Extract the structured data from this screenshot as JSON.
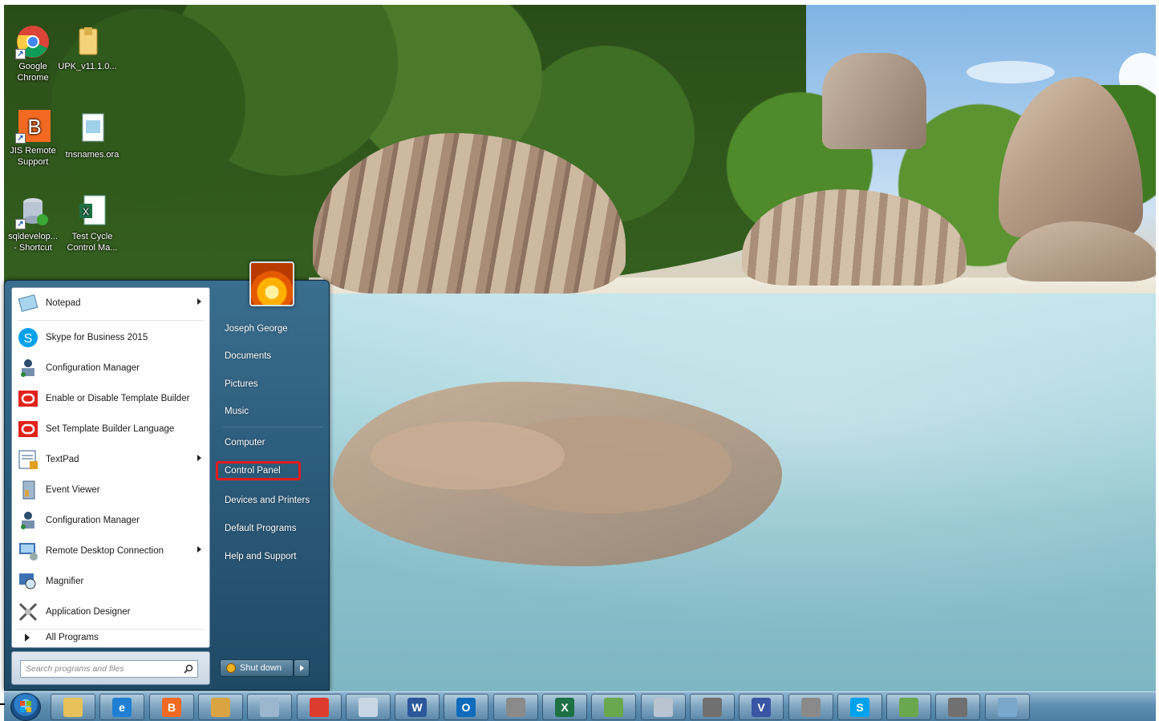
{
  "desktop": {
    "icons": [
      {
        "name": "chrome-icon",
        "label_lines": [
          "Google",
          "Chrome"
        ]
      },
      {
        "name": "folder-icon",
        "label_lines": [
          "UPK_v11.1.0..."
        ]
      },
      {
        "name": "jis-remote-icon",
        "label_lines": [
          "JIS Remote",
          "Support"
        ]
      },
      {
        "name": "tnsnames-icon",
        "label_lines": [
          "tnsnames.ora"
        ]
      },
      {
        "name": "sqldeveloper-icon",
        "label_lines": [
          "sqldevelop...",
          "- Shortcut"
        ]
      },
      {
        "name": "excel-file-icon",
        "label_lines": [
          "Test Cycle",
          "Control Ma..."
        ]
      }
    ]
  },
  "start_menu": {
    "programs": [
      {
        "label": "Notepad",
        "icon": "notepad-icon",
        "submenu": true
      },
      {
        "label": "Skype for Business 2015",
        "icon": "skype-icon",
        "submenu": false
      },
      {
        "label": "Configuration Manager",
        "icon": "config-manager-icon",
        "submenu": false
      },
      {
        "label": "Enable or Disable Template Builder",
        "icon": "oracle-icon",
        "submenu": false
      },
      {
        "label": "Set Template Builder Language",
        "icon": "oracle-icon",
        "submenu": false
      },
      {
        "label": "TextPad",
        "icon": "textpad-icon",
        "submenu": true
      },
      {
        "label": "Event Viewer",
        "icon": "event-viewer-icon",
        "submenu": false
      },
      {
        "label": "Configuration Manager",
        "icon": "config-manager-icon",
        "submenu": false
      },
      {
        "label": "Remote Desktop Connection",
        "icon": "remote-desktop-icon",
        "submenu": true
      },
      {
        "label": "Magnifier",
        "icon": "magnifier-icon",
        "submenu": false
      },
      {
        "label": "Application Designer",
        "icon": "app-designer-icon",
        "submenu": false
      }
    ],
    "all_programs": "All Programs",
    "search_placeholder": "Search programs and files",
    "right_items": {
      "user": "Joseph George",
      "documents": "Documents",
      "pictures": "Pictures",
      "music": "Music",
      "computer": "Computer",
      "control_panel": "Control Panel",
      "devices": "Devices and Printers",
      "default_programs": "Default Programs",
      "help": "Help and Support"
    },
    "shutdown_label": "Shut down",
    "highlight_color": "#e41b1b"
  },
  "taskbar": {
    "buttons": [
      {
        "name": "explorer-taskbar-button",
        "glyph": "",
        "color": "#e8c15a"
      },
      {
        "name": "ie-taskbar-button",
        "glyph": "e",
        "color": "#1e7fd3"
      },
      {
        "name": "jis-taskbar-button",
        "glyph": "B",
        "color": "#f26a21"
      },
      {
        "name": "lock-taskbar-button",
        "glyph": "",
        "color": "#d9a441"
      },
      {
        "name": "remote-taskbar-button",
        "glyph": "",
        "color": "#9bb6cf"
      },
      {
        "name": "chrome-taskbar-button",
        "glyph": "",
        "color": "#de3b2f"
      },
      {
        "name": "snipping-taskbar-button",
        "glyph": "",
        "color": "#c9d7e4"
      },
      {
        "name": "word-taskbar-button",
        "glyph": "W",
        "color": "#2b579a"
      },
      {
        "name": "outlook-taskbar-button",
        "glyph": "O",
        "color": "#0f6cbd"
      },
      {
        "name": "tools-taskbar-button",
        "glyph": "",
        "color": "#8a8a8a"
      },
      {
        "name": "excel-taskbar-button",
        "glyph": "X",
        "color": "#1e7145"
      },
      {
        "name": "sql-taskbar-button",
        "glyph": "",
        "color": "#6aa84f"
      },
      {
        "name": "calculator-taskbar-button",
        "glyph": "",
        "color": "#b8c4cf"
      },
      {
        "name": "app-taskbar-button",
        "glyph": "",
        "color": "#707070"
      },
      {
        "name": "visio-taskbar-button",
        "glyph": "V",
        "color": "#3955a3"
      },
      {
        "name": "tools2-taskbar-button",
        "glyph": "",
        "color": "#8a8a8a"
      },
      {
        "name": "skype-taskbar-button",
        "glyph": "S",
        "color": "#00a2ed"
      },
      {
        "name": "sql2-taskbar-button",
        "glyph": "",
        "color": "#6aa84f"
      },
      {
        "name": "app2-taskbar-button",
        "glyph": "",
        "color": "#707070"
      },
      {
        "name": "window-taskbar-button",
        "glyph": "",
        "color": "#7aa7cc"
      }
    ]
  }
}
